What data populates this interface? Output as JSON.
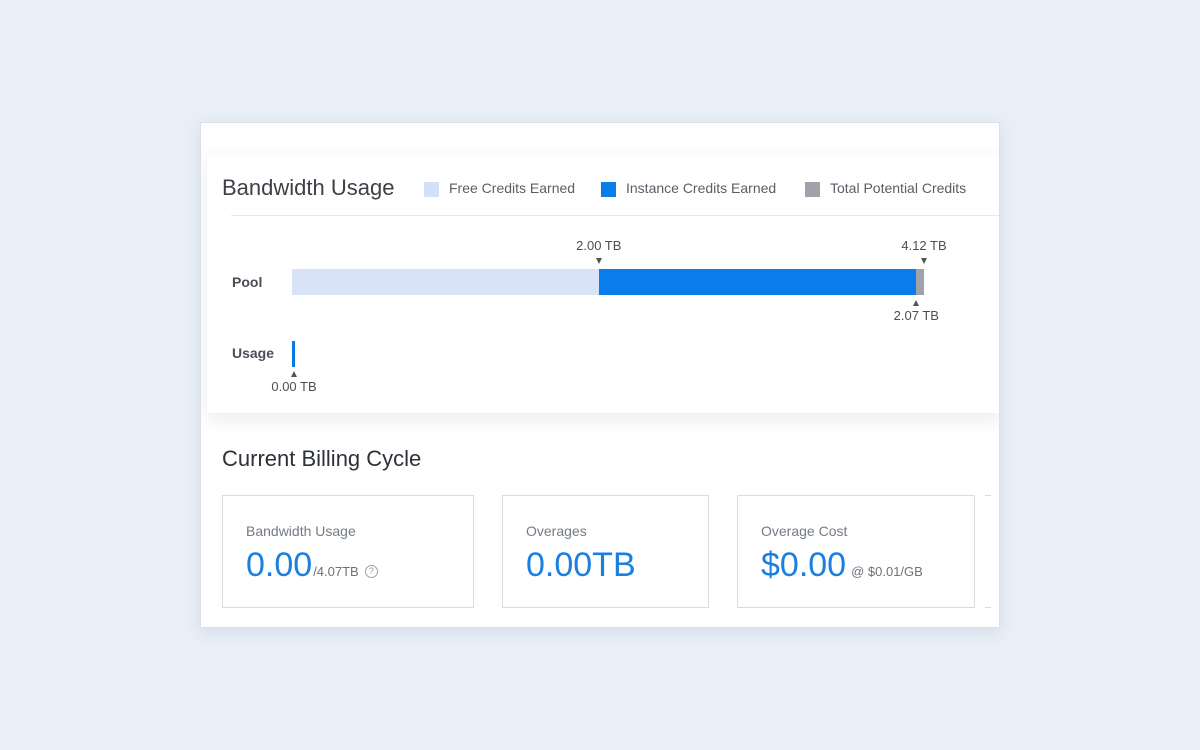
{
  "bandwidth": {
    "title": "Bandwidth Usage",
    "legend": [
      {
        "label": "Free Credits Earned",
        "color": "#d3e1f8"
      },
      {
        "label": "Instance Credits Earned",
        "color": "#0a7ded"
      },
      {
        "label": "Total Potential Credits",
        "color": "#9fa2a9"
      }
    ],
    "pool": {
      "label": "Pool",
      "free_tb": 2.0,
      "instance_tb": 4.07,
      "total_tb": 4.12,
      "markers": {
        "free": "2.00 TB",
        "total": "4.12 TB",
        "instance": "2.07 TB"
      }
    },
    "usage": {
      "label": "Usage",
      "value_tb": 0.0,
      "marker": "0.00 TB"
    }
  },
  "billing": {
    "title": "Current Billing Cycle",
    "cards": [
      {
        "label": "Bandwidth Usage",
        "value": "0.00",
        "suffix": "/4.07TB",
        "help": "?"
      },
      {
        "label": "Overages",
        "value": "0.00TB"
      },
      {
        "label": "Overage Cost",
        "value": "$0.00",
        "suffix": "@ $0.01/GB"
      }
    ]
  }
}
